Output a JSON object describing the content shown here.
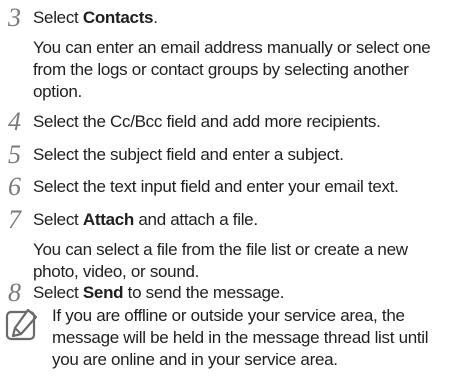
{
  "steps": [
    {
      "number": "3",
      "main": {
        "prefix": "Select ",
        "bold": "Contacts",
        "suffix": "."
      },
      "detail": [
        "You can enter an email address manually or select one",
        "from the logs or contact groups by selecting another",
        "option."
      ]
    },
    {
      "number": "4",
      "main": {
        "prefix": "Select the Cc/Bcc field and add more recipients.",
        "bold": "",
        "suffix": ""
      },
      "detail": []
    },
    {
      "number": "5",
      "main": {
        "prefix": "Select the subject field and enter a subject.",
        "bold": "",
        "suffix": ""
      },
      "detail": []
    },
    {
      "number": "6",
      "main": {
        "prefix": "Select the text input field and enter your email text.",
        "bold": "",
        "suffix": ""
      },
      "detail": []
    },
    {
      "number": "7",
      "main": {
        "prefix": "Select ",
        "bold": "Attach",
        "suffix": " and attach a file."
      },
      "detail": [
        "You can select a file from the file list or create a new",
        "photo, video, or sound."
      ]
    },
    {
      "number": "8",
      "main": {
        "prefix": "Select ",
        "bold": "Send",
        "suffix": " to send the message."
      },
      "detail": []
    }
  ],
  "note": {
    "icon": "note-pencil-icon",
    "lines": [
      "If you are offline or outside your service area, the",
      "message will be held in the message thread list until",
      "you are online and in your service area."
    ]
  }
}
